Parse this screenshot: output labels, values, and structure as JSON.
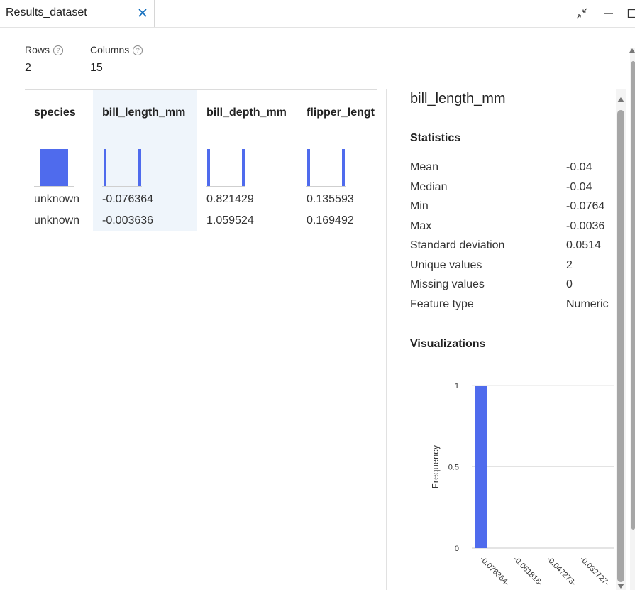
{
  "tab": {
    "title": "Results_dataset",
    "close_icon": "close-icon"
  },
  "window_controls": {
    "collapse_icon": "collapse-icon",
    "minimize_icon": "minimize-icon",
    "maximize_icon": "maximize-icon"
  },
  "summary": {
    "rows_label": "Rows",
    "rows_value": "2",
    "columns_label": "Columns",
    "columns_value": "15",
    "help_glyph": "?"
  },
  "table": {
    "columns": [
      "species",
      "bill_length_mm",
      "bill_depth_mm",
      "flipper_lengt"
    ],
    "rows": [
      [
        "unknown",
        "-0.076364",
        "0.821429",
        "0.135593"
      ],
      [
        "unknown",
        "-0.003636",
        "1.059524",
        "0.169492"
      ]
    ],
    "selected_column": "bill_length_mm"
  },
  "panel": {
    "title": "bill_length_mm",
    "statistics_title": "Statistics",
    "stats": [
      {
        "label": "Mean",
        "value": "-0.04"
      },
      {
        "label": "Median",
        "value": "-0.04"
      },
      {
        "label": "Min",
        "value": "-0.0764"
      },
      {
        "label": "Max",
        "value": "-0.0036"
      },
      {
        "label": "Standard deviation",
        "value": "0.0514"
      },
      {
        "label": "Unique values",
        "value": "2"
      },
      {
        "label": "Missing values",
        "value": "0"
      },
      {
        "label": "Feature type",
        "value": "Numeric"
      }
    ],
    "visualizations_title": "Visualizations"
  },
  "colors": {
    "accent": "#4f6bed",
    "highlight": "#eff5fb"
  },
  "chart_data": {
    "type": "bar",
    "ylabel": "Frequency",
    "y_ticks": [
      "1",
      "0.5",
      "0"
    ],
    "ylim": [
      0,
      1
    ],
    "x_ticks": [
      "-0.076364-",
      "-0.061818-",
      "-0.047273-",
      "-0.032727-"
    ],
    "series": [
      {
        "values": [
          1,
          0,
          0,
          0
        ]
      }
    ],
    "grid": true
  }
}
